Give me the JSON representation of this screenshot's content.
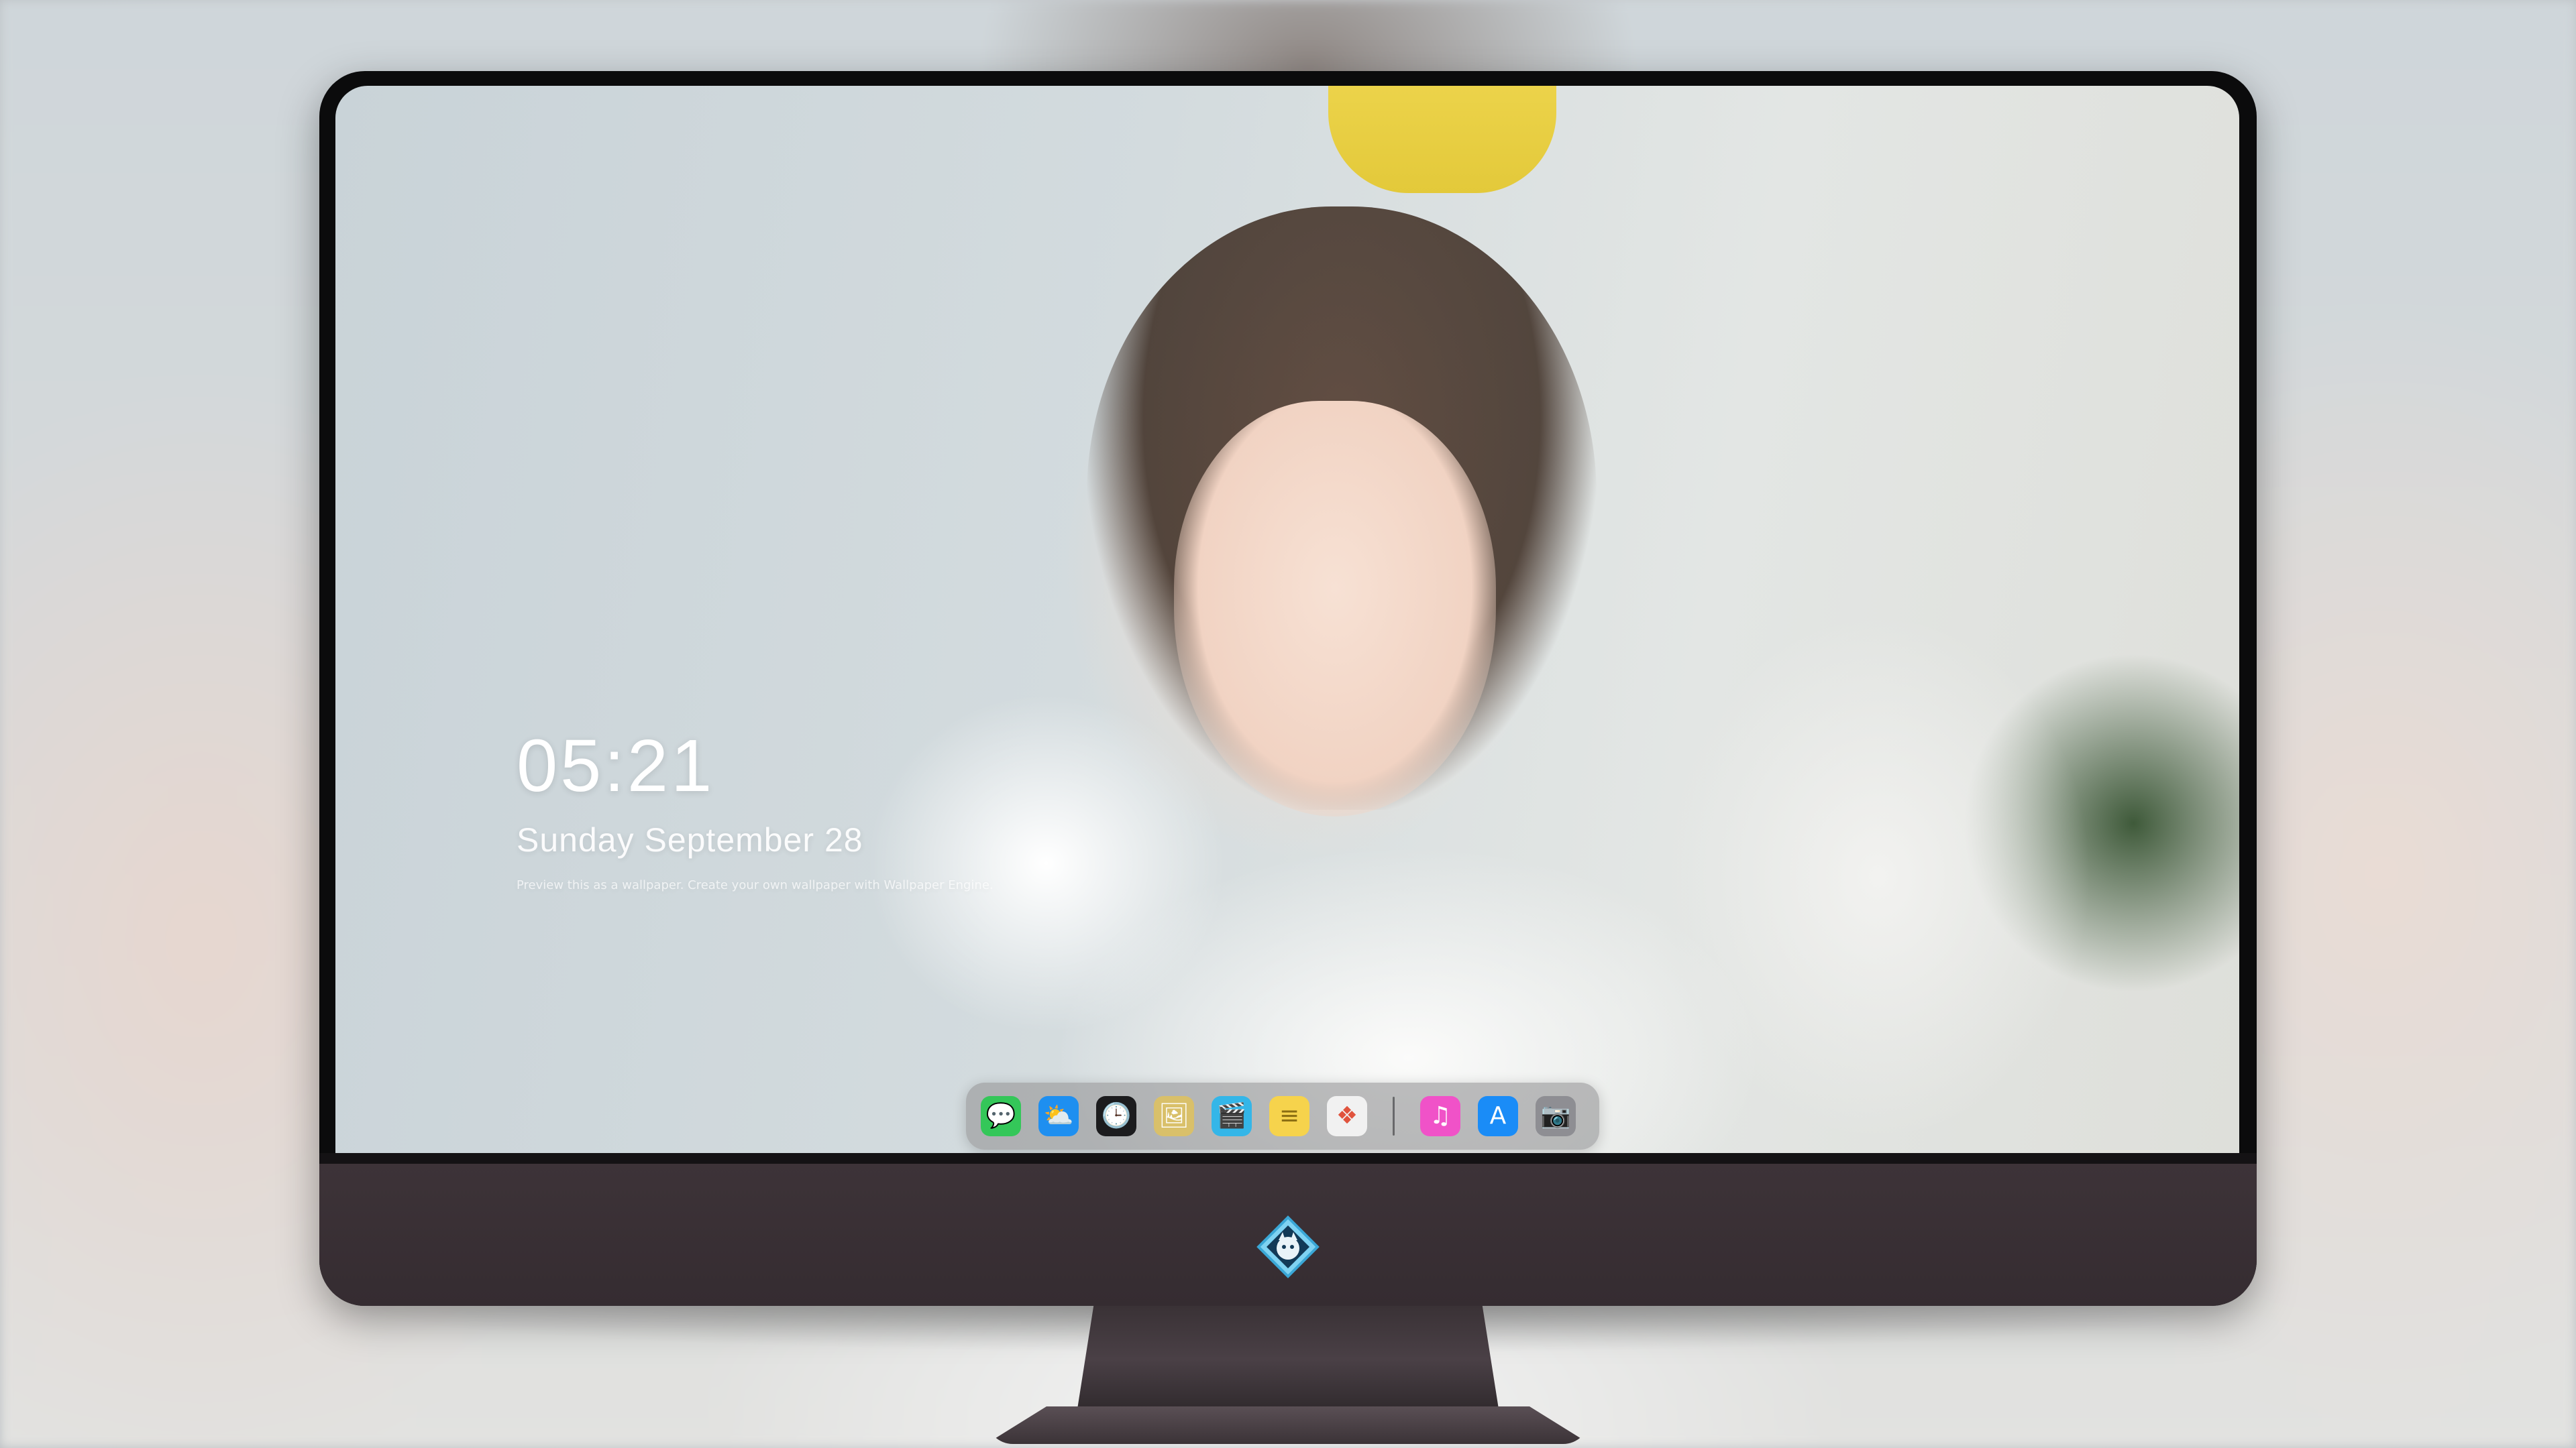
{
  "lockscreen": {
    "time": "05:21",
    "date": "Sunday September  28",
    "note": "Preview this as a wallpaper. Create your own wallpaper with Wallpaper Engine."
  },
  "dock": {
    "apps": [
      {
        "name": "Messages",
        "icon": "messages-icon",
        "glyph": "💬",
        "color": "#34c759"
      },
      {
        "name": "Weather",
        "icon": "weather-icon",
        "glyph": "⛅",
        "color": "#1e8ff0"
      },
      {
        "name": "Clock",
        "icon": "clock-icon",
        "glyph": "🕒",
        "color": "#1c1c1e"
      },
      {
        "name": "Preview",
        "icon": "preview-icon",
        "glyph": "🖼",
        "color": "#d9c06a"
      },
      {
        "name": "Clips",
        "icon": "clips-icon",
        "glyph": "🎬",
        "color": "#34b6e8"
      },
      {
        "name": "Notes",
        "icon": "notes-icon",
        "glyph": "≡",
        "color": "#f6d34c"
      },
      {
        "name": "Photos",
        "icon": "photos-icon",
        "glyph": "❖",
        "color": "#f1f1f1"
      },
      {
        "name": "Music",
        "icon": "music-icon",
        "glyph": "♫",
        "color": "#f052c8"
      },
      {
        "name": "App Store",
        "icon": "app-store-icon",
        "glyph": "A",
        "color": "#1a8cf7"
      },
      {
        "name": "Camera",
        "icon": "camera-icon",
        "glyph": "📷",
        "color": "#8e8e93"
      }
    ]
  },
  "colors": {
    "monitor_bezel": "#0b0b0c",
    "monitor_chin": "#3d3338",
    "dock_background": "rgba(150,150,152,0.62)",
    "clock_text": "#ffffff"
  }
}
